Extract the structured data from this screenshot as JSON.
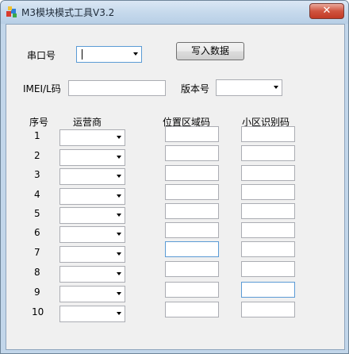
{
  "window": {
    "title": "M3模块模式工具V3.2",
    "close_label": "✕"
  },
  "form": {
    "port_label": "串口号",
    "port_value": "",
    "write_button": "写入数据",
    "imei_label": "IMEI/L码",
    "imei_value": "",
    "version_label": "版本号",
    "version_value": ""
  },
  "table": {
    "headers": {
      "index": "序号",
      "operator": "运营商",
      "lac": "位置区域码",
      "cell_id": "小区识别码"
    },
    "rows": [
      {
        "index": "1",
        "operator": "",
        "lac": "",
        "cell_id": ""
      },
      {
        "index": "2",
        "operator": "",
        "lac": "",
        "cell_id": ""
      },
      {
        "index": "3",
        "operator": "",
        "lac": "",
        "cell_id": ""
      },
      {
        "index": "4",
        "operator": "",
        "lac": "",
        "cell_id": ""
      },
      {
        "index": "5",
        "operator": "",
        "lac": "",
        "cell_id": ""
      },
      {
        "index": "6",
        "operator": "",
        "lac": "",
        "cell_id": ""
      },
      {
        "index": "7",
        "operator": "",
        "lac": "",
        "cell_id": ""
      },
      {
        "index": "8",
        "operator": "",
        "lac": "",
        "cell_id": ""
      },
      {
        "index": "9",
        "operator": "",
        "lac": "",
        "cell_id": ""
      },
      {
        "index": "10",
        "operator": "",
        "lac": "",
        "cell_id": ""
      }
    ]
  },
  "icons": {
    "app": "app-colorful-blocks-icon",
    "close": "close-icon",
    "dropdown": "chevron-down-icon"
  },
  "colors": {
    "titlebar": "#c6d9ec",
    "close_button": "#c23a25",
    "client_bg": "#f0f0f0",
    "focus_border": "#5b9bd5"
  }
}
